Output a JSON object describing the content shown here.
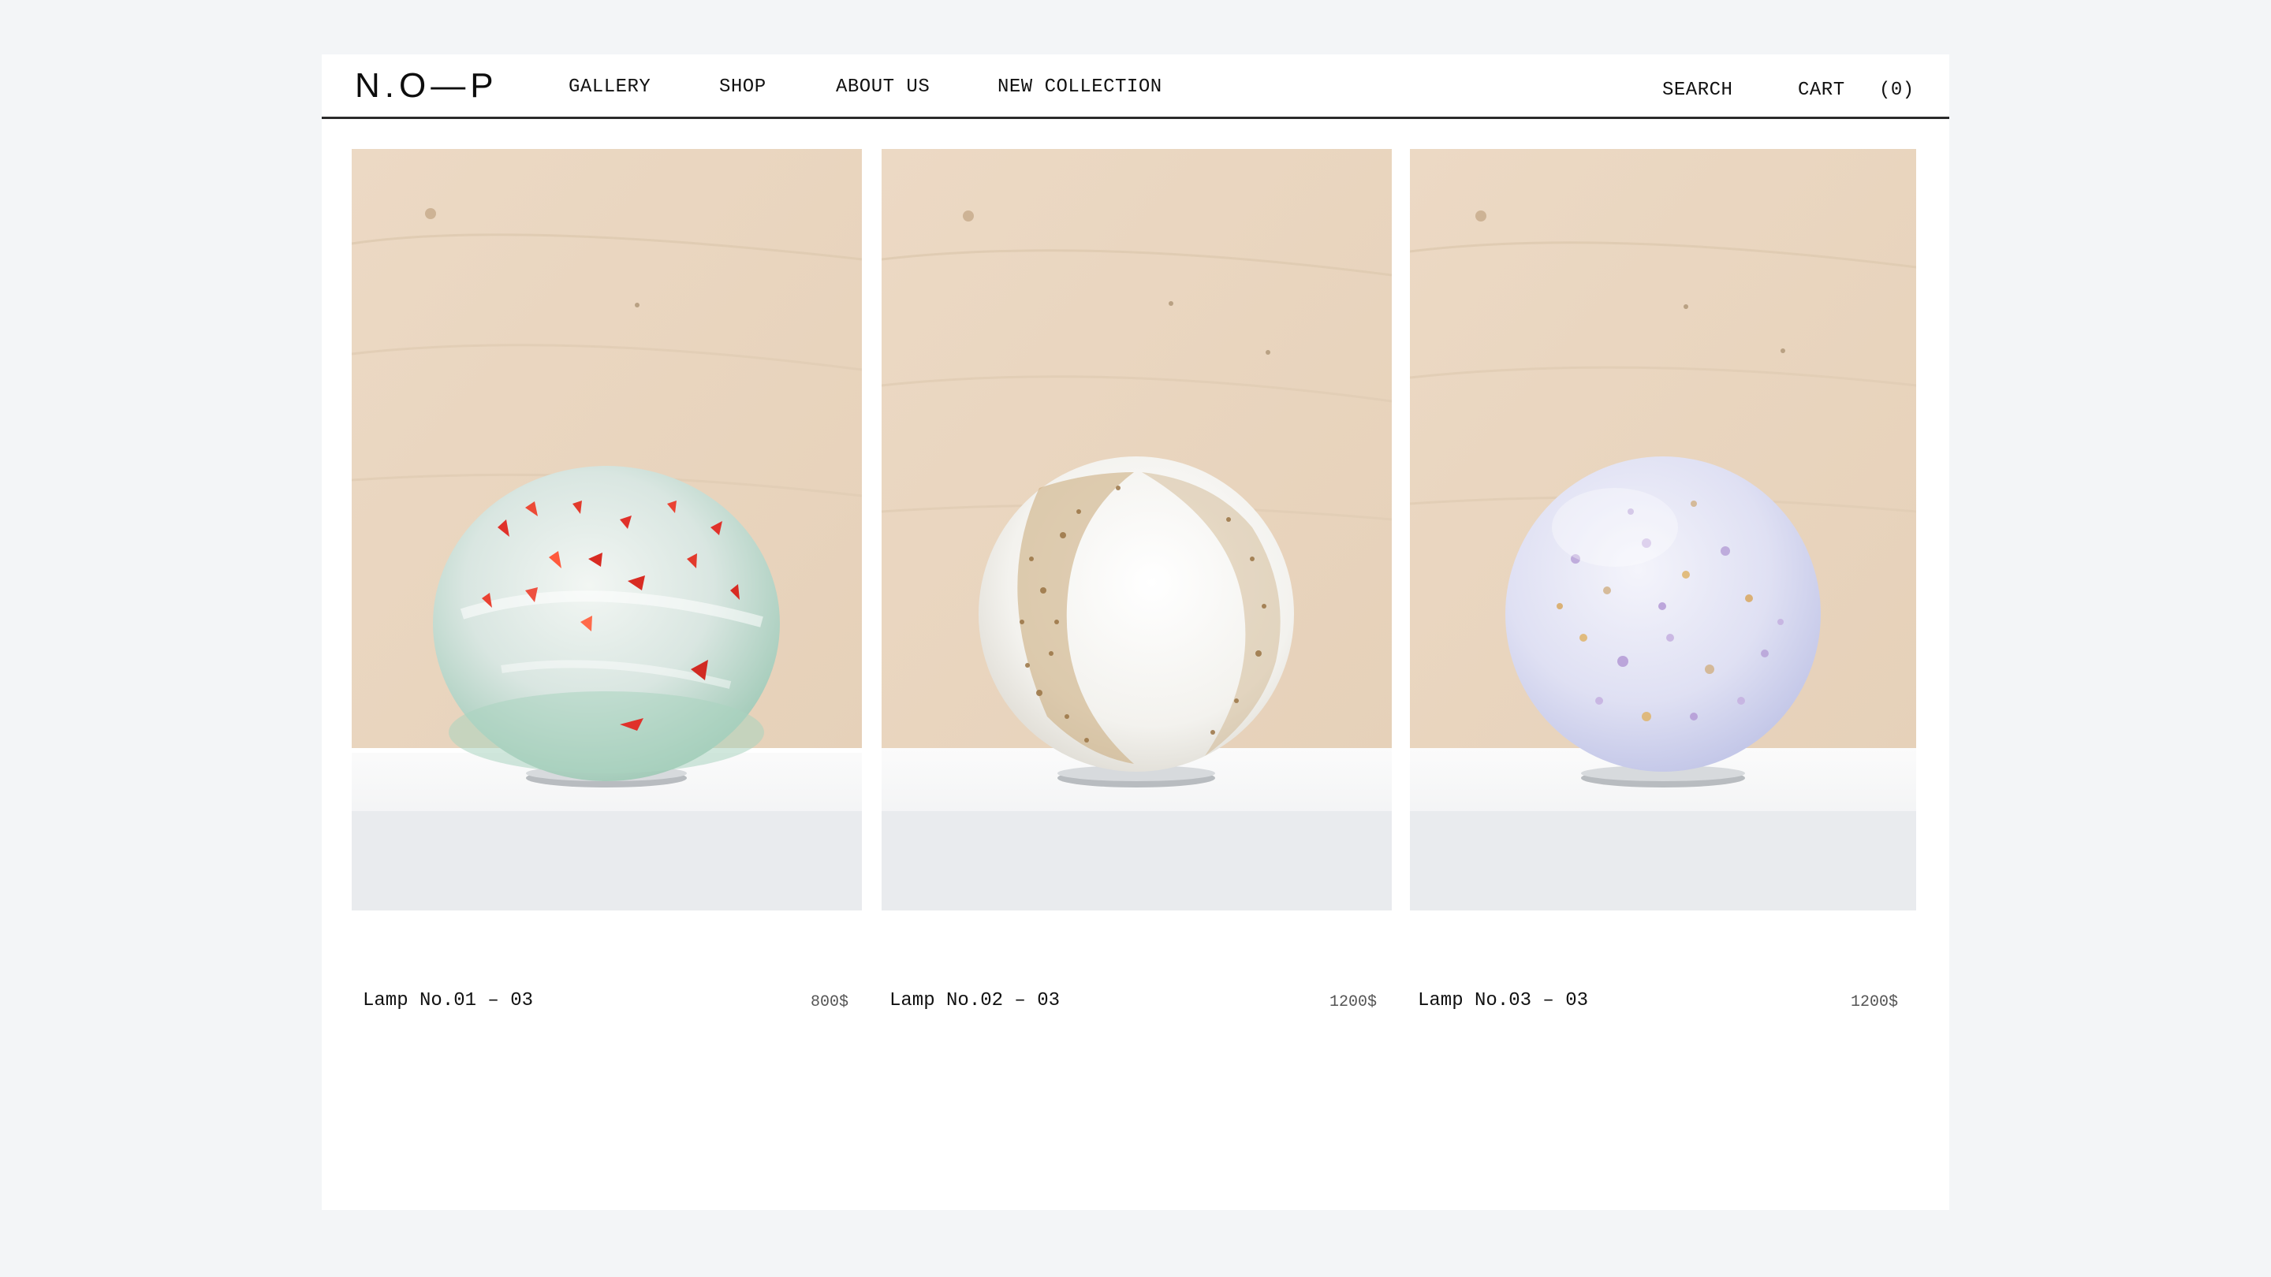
{
  "brand": {
    "logo": "N.O—P"
  },
  "nav": {
    "items": [
      {
        "label": "GALLERY"
      },
      {
        "label": "SHOP"
      },
      {
        "label": "ABOUT US"
      },
      {
        "label": "NEW COLLECTION"
      }
    ],
    "search_label": "SEARCH",
    "cart_label": "CART",
    "cart_count": "(0)"
  },
  "products": [
    {
      "name": "Lamp No.01 – 03",
      "price": "800$",
      "image": "green-glass-lamp-with-red-flecks"
    },
    {
      "name": "Lamp No.02 – 03",
      "price": "1200$",
      "image": "white-glass-lamp-with-amber-speckles"
    },
    {
      "name": "Lamp No.03 – 03",
      "price": "1200$",
      "image": "lilac-glass-lamp-with-confetti-speckles"
    }
  ],
  "colors": {
    "background": "#f3f5f7",
    "page": "#ffffff",
    "text": "#111111",
    "divider": "#2b2b2b",
    "wood": "#ecd9c4",
    "shelf": "#f7f7f8"
  }
}
